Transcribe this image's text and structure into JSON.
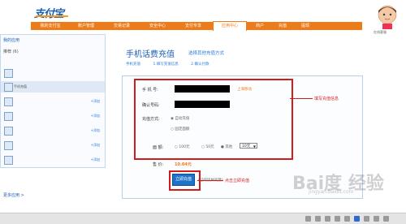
{
  "logo": "支付宝",
  "top_user": [
    "",
    ""
  ],
  "nav_tabs": [
    "我的支付宝",
    "账户管理",
    "交易记录",
    "安全中心",
    "支付专享",
    "应用中心",
    "商户",
    "充值",
    "提现"
  ],
  "sidebar": {
    "header": "我的应用",
    "subheader": "推荐 (6)",
    "items": [
      {
        "label": "手机充值",
        "action": "+添加"
      },
      {
        "label": "",
        "action": "+添加"
      },
      {
        "label": "",
        "action": "+添加"
      },
      {
        "label": "",
        "action": "+添加"
      },
      {
        "label": "",
        "action": "+添加"
      },
      {
        "label": "",
        "action": "+添加"
      },
      {
        "label": "",
        "action": "+添加"
      }
    ],
    "more": "更多应用 >"
  },
  "page": {
    "title": "手机话费充值",
    "subtitle": "选择其他充值方式"
  },
  "subnav": [
    "手机充值",
    "1.填写充值信息",
    "2.确认付款"
  ],
  "form": {
    "phone_label": "手 机 号:",
    "phone_hint": "上海移动",
    "confirm_label": "确认号码:",
    "method_label": "充值方式:",
    "method_opt1": "◉ 自动充值",
    "method_opt2": "○ 固定面额",
    "amount_label": "面 额:",
    "amount_opts": [
      "○ 100元",
      "○ 50元",
      "● 其他"
    ],
    "amount_select": "10元",
    "price_label": "售 价:",
    "price_value": "10.04元",
    "submit_label": "立即充值",
    "submit_hint": "(已阅读并同意)"
  },
  "callouts": {
    "fill_info": "填写充值信息",
    "click_pay": "点击立即充值"
  },
  "avatar_label": "在线客服",
  "watermark": "Bai度 经验",
  "watermark_url": "jingyan.baidu.com"
}
